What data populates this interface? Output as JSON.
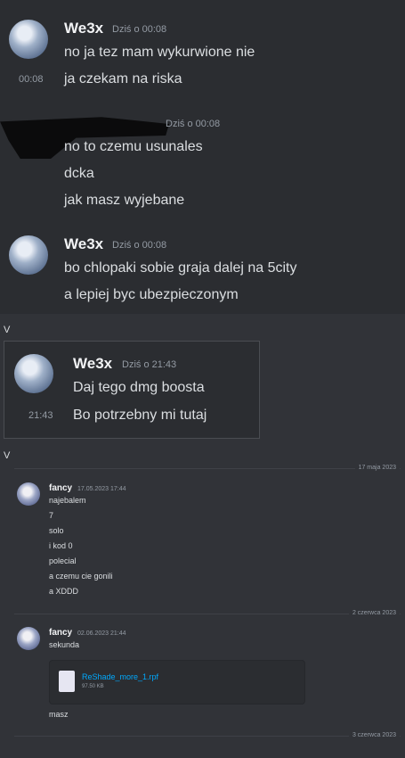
{
  "screenshot1": {
    "groups": [
      {
        "author": "We3x",
        "time": "Dziś o 00:08",
        "lines": [
          "no ja tez mam wykurwione nie",
          "ja czekam na riska"
        ],
        "side_time": "00:08"
      },
      {
        "author": "",
        "time": "Dziś o 00:08",
        "lines": [
          "no to czemu usunales",
          "dcka",
          "jak masz wyjebane"
        ]
      },
      {
        "author": "We3x",
        "time": "Dziś o 00:08",
        "lines": [
          "bo chlopaki sobie graja dalej na 5city",
          "a lepiej byc ubezpieczonym"
        ]
      }
    ]
  },
  "separator_labels": [
    "V",
    "V"
  ],
  "screenshot2": {
    "author": "We3x",
    "time": "Dziś o 21:43",
    "lines": [
      "Daj tego dmg boosta",
      "Bo potrzebny mi tutaj"
    ],
    "side_time": "21:43"
  },
  "screenshot3": {
    "date_separators": [
      "17 maja 2023",
      "2 czerwca 2023",
      "3 czerwca 2023"
    ],
    "group1": {
      "author": "fancy",
      "time": "17.05.2023 17:44",
      "lines": [
        "najebalem",
        "7",
        "solo",
        "i kod 0",
        "polecial",
        "a czemu cie gonili",
        "a XDDD"
      ]
    },
    "group2": {
      "author": "fancy",
      "time": "02.06.2023 21:44",
      "lines": [
        "sekunda"
      ],
      "after_lines": [
        "masz"
      ],
      "file": {
        "name": "ReShade_more_1.rpf",
        "size": "97.50 KB"
      }
    }
  },
  "colors": {
    "background": "#313338",
    "panel": "#2b2d31",
    "link": "#00a8fc"
  }
}
